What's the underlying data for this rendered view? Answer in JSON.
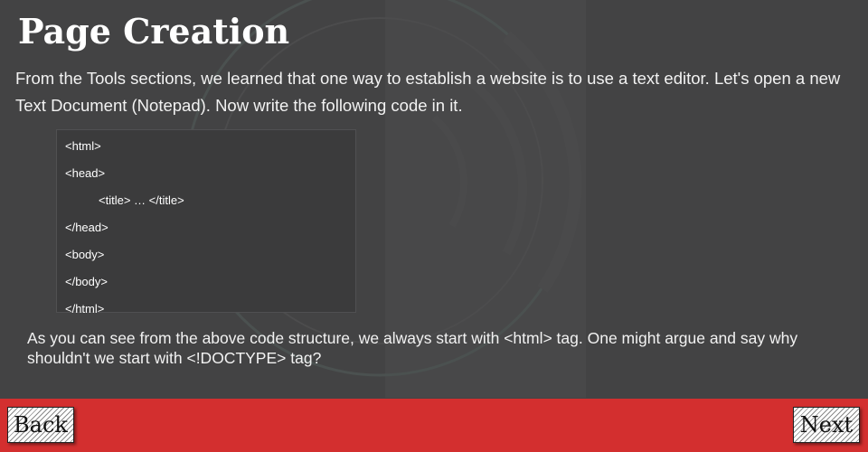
{
  "page": {
    "title": "Page Creation",
    "intro": "From the Tools sections, we learned that one way to establish a website is to use a text editor. Let's open a new Text Document (Notepad). Now write the following code in it.",
    "code_lines": [
      "<html>",
      "<head>",
      "<title> … </title>",
      "</head>",
      "<body>",
      "</body>",
      "</html>"
    ],
    "followup": "As you can see from the above code structure, we always start with <html> tag. One might argue and say why shouldn't we start with <!DOCTYPE> tag?"
  },
  "footer": {
    "back_label": "Back",
    "next_label": "Next"
  },
  "colors": {
    "background": "#434344",
    "footer": "#d32f2f",
    "code_box": "#3b3b3c"
  }
}
